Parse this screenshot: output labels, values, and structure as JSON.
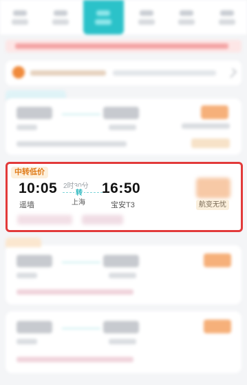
{
  "highlighted_flight": {
    "tag": "中转低价",
    "departure_time": "10:05",
    "departure_airport": "遥墙",
    "duration": "2时30分",
    "transfer_mark": "转",
    "transfer_city": "上海",
    "arrival_time": "16:50",
    "arrival_airport": "宝安T3",
    "badge": "航变无忧"
  },
  "colors": {
    "accent": "#2bc2c9",
    "highlight_border": "#e23a3a",
    "tag_text": "#e07a17"
  }
}
